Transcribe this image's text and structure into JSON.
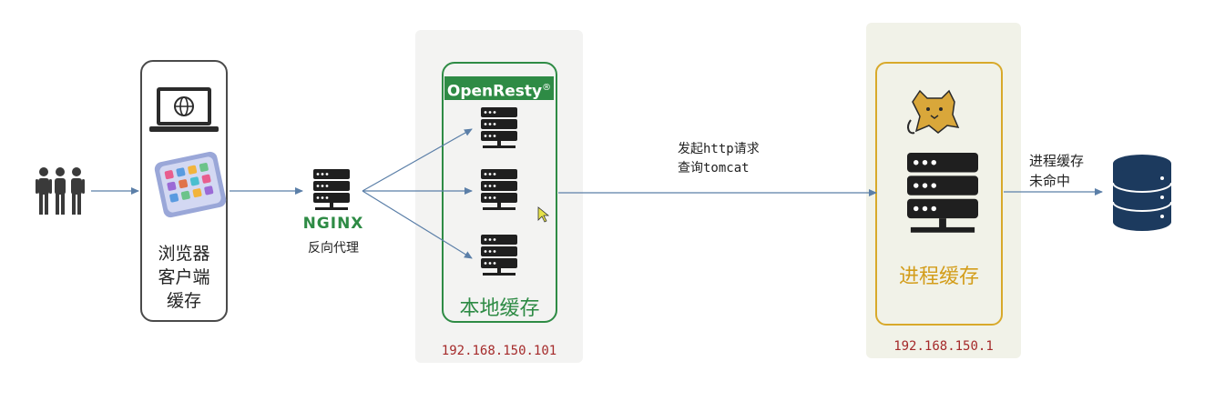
{
  "client": {
    "label_lines": [
      "浏览器",
      "客户端",
      "缓存"
    ]
  },
  "nginx": {
    "logo": "NGINX",
    "label": "反向代理"
  },
  "openresty": {
    "logo": "OpenResty",
    "registered": "®",
    "label": "本地缓存",
    "ip": "192.168.150.101"
  },
  "request": {
    "lines": [
      "发起http请求",
      "查询tomcat"
    ]
  },
  "tomcat": {
    "label": "进程缓存",
    "ip": "192.168.150.1"
  },
  "miss": {
    "lines": [
      "进程缓存",
      "未命中"
    ]
  },
  "colors": {
    "green": "#2e8b45",
    "gold": "#d8a92a",
    "server": "#1f1f1f",
    "arrow": "#5b7fa8",
    "db": "#1c3a5e",
    "ip_red": "#a52a2a"
  },
  "icons": [
    "users-icon",
    "laptop-globe-icon",
    "smartphone-icon",
    "server-icon",
    "tomcat-cat-icon",
    "database-icon",
    "mouse-cursor-icon"
  ]
}
